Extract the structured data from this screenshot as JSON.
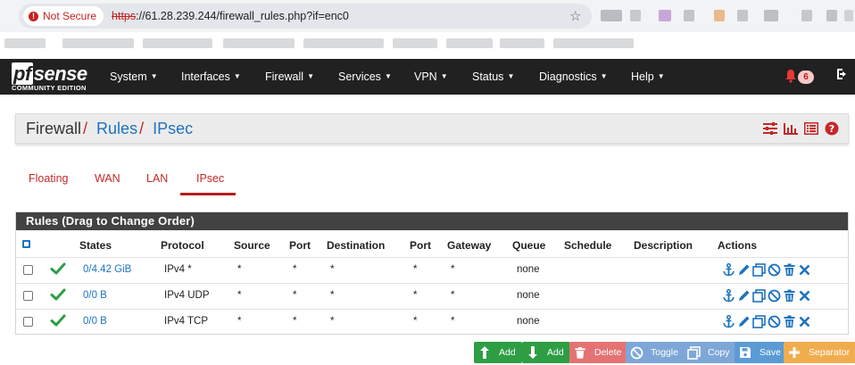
{
  "browser": {
    "security_label": "Not Secure",
    "url_scheme": "https",
    "url_rest": "://61.28.239.244/firewall_rules.php?if=enc0"
  },
  "navbar": {
    "logo_text": "sense",
    "logo_pf": "pf",
    "edition": "COMMUNITY EDITION",
    "items": [
      {
        "label": "System"
      },
      {
        "label": "Interfaces"
      },
      {
        "label": "Firewall"
      },
      {
        "label": "Services"
      },
      {
        "label": "VPN"
      },
      {
        "label": "Status"
      },
      {
        "label": "Diagnostics"
      },
      {
        "label": "Help"
      }
    ],
    "notification_count": "6"
  },
  "header": {
    "crumb_root": "Firewall",
    "crumb_rules": "Rules",
    "crumb_current": "IPsec",
    "icons": [
      "sliders-icon",
      "bar-chart-icon",
      "list-icon",
      "help-icon"
    ]
  },
  "tabs": [
    {
      "label": "Floating"
    },
    {
      "label": "WAN"
    },
    {
      "label": "LAN"
    },
    {
      "label": "IPsec",
      "active": true
    }
  ],
  "panel": {
    "title": "Rules (Drag to Change Order)",
    "columns": [
      "States",
      "Protocol",
      "Source",
      "Port",
      "Destination",
      "Port",
      "Gateway",
      "Queue",
      "Schedule",
      "Description",
      "Actions"
    ],
    "rows": [
      {
        "states": "0/4.42 GiB",
        "protocol": "IPv4 *",
        "source": "*",
        "port": "*",
        "destination": "*",
        "dport": "*",
        "gateway": "*",
        "queue": "none",
        "schedule": "",
        "description": ""
      },
      {
        "states": "0/0 B",
        "protocol": "IPv4 UDP",
        "source": "*",
        "port": "*",
        "destination": "*",
        "dport": "*",
        "gateway": "*",
        "queue": "none",
        "schedule": "",
        "description": ""
      },
      {
        "states": "0/0 B",
        "protocol": "IPv4 TCP",
        "source": "*",
        "port": "*",
        "destination": "*",
        "dport": "*",
        "gateway": "*",
        "queue": "none",
        "schedule": "",
        "description": ""
      }
    ]
  },
  "buttons": {
    "add_top": "Add",
    "add_bottom": "Add",
    "delete": "Delete",
    "toggle": "Toggle",
    "copy": "Copy",
    "save": "Save",
    "separator": "Separator"
  },
  "colors": {
    "success": "#2e9e45",
    "danger": "#e57373",
    "info": "#7ea7d8",
    "primary": "#5b9bd5",
    "warning": "#f0ad4e",
    "link": "#1e73be",
    "accent": "#c62828"
  }
}
